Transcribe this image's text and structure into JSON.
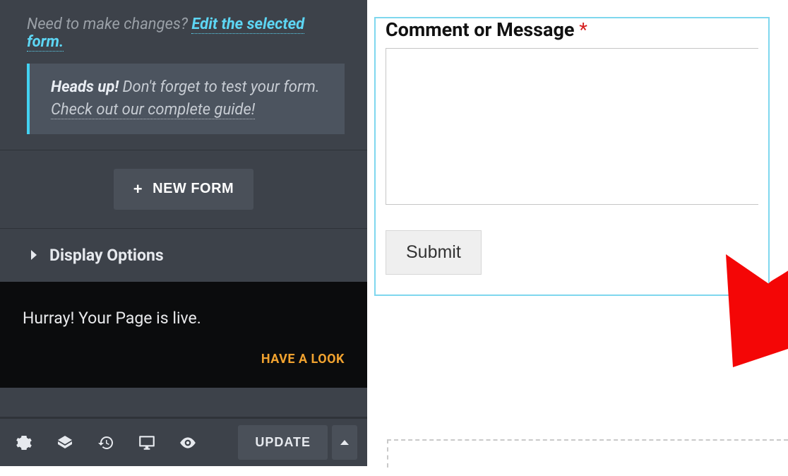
{
  "sidebar": {
    "prompt_text": "Need to make changes? ",
    "edit_link": "Edit the selected form.",
    "heads_up": {
      "label": "Heads up!",
      "body": " Don't forget to test your form. ",
      "guide_link": "Check out our complete guide!"
    },
    "new_form_label": "NEW FORM",
    "display_options_label": "Display Options",
    "live_notice": "Hurray! Your Page is live.",
    "have_a_look": "HAVE A LOOK",
    "update_label": "UPDATE"
  },
  "form": {
    "field_label": "Comment or Message ",
    "required": "*",
    "textarea_value": "",
    "submit_label": "Submit"
  }
}
